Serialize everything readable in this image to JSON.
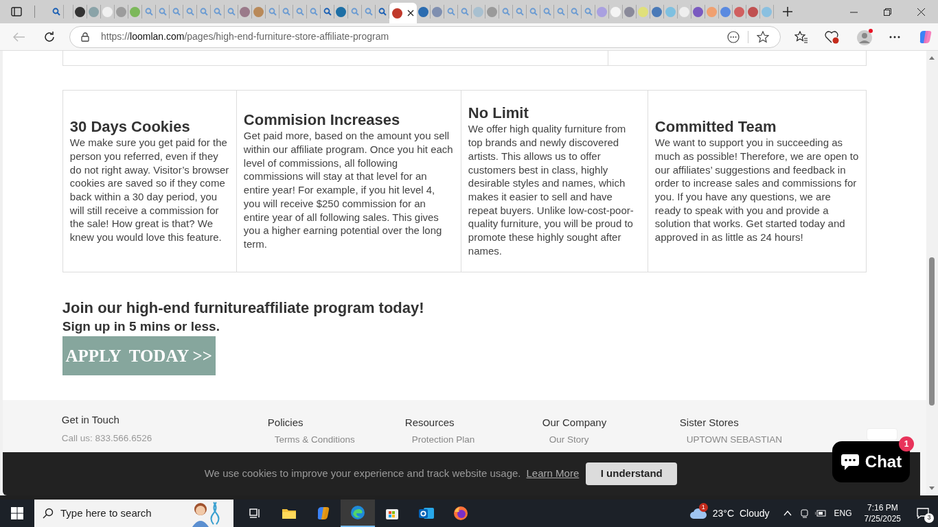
{
  "browser": {
    "tabs": [
      {
        "kind": "search",
        "selected": false,
        "color": "#1a5fb4"
      },
      {
        "kind": "site",
        "selected": false,
        "color": "#333333"
      },
      {
        "kind": "site",
        "selected": false,
        "color": "#8aa3a8"
      },
      {
        "kind": "site",
        "selected": false,
        "color": "#f0f0f0"
      },
      {
        "kind": "site",
        "selected": false,
        "color": "#9c9c9c"
      },
      {
        "kind": "site",
        "selected": false,
        "color": "#7cb85a"
      },
      {
        "kind": "search",
        "selected": false,
        "color": "#6b9bd2"
      },
      {
        "kind": "search",
        "selected": false,
        "color": "#6b9bd2"
      },
      {
        "kind": "search",
        "selected": false,
        "color": "#6b9bd2"
      },
      {
        "kind": "search",
        "selected": false,
        "color": "#6b9bd2"
      },
      {
        "kind": "search",
        "selected": false,
        "color": "#6b9bd2"
      },
      {
        "kind": "search",
        "selected": false,
        "color": "#6b9bd2"
      },
      {
        "kind": "search",
        "selected": false,
        "color": "#6b9bd2"
      },
      {
        "kind": "site",
        "selected": false,
        "color": "#9a7a8a"
      },
      {
        "kind": "site",
        "selected": false,
        "color": "#b98a5a"
      },
      {
        "kind": "search",
        "selected": false,
        "color": "#6b9bd2"
      },
      {
        "kind": "search",
        "selected": false,
        "color": "#6b9bd2"
      },
      {
        "kind": "search",
        "selected": false,
        "color": "#6b9bd2"
      },
      {
        "kind": "search",
        "selected": false,
        "color": "#6b9bd2"
      },
      {
        "kind": "search",
        "selected": false,
        "color": "#1a5fb4"
      },
      {
        "kind": "site",
        "selected": false,
        "color": "#1d6fa5"
      },
      {
        "kind": "search",
        "selected": false,
        "color": "#6b9bd2"
      },
      {
        "kind": "search",
        "selected": false,
        "color": "#6b9bd2"
      },
      {
        "kind": "search",
        "selected": false,
        "color": "#1a5fb4"
      },
      {
        "kind": "site",
        "selected": true,
        "color": "#c0392b"
      },
      {
        "kind": "site",
        "selected": false,
        "color": "#2b6cb0"
      },
      {
        "kind": "site",
        "selected": false,
        "color": "#7f8fb0"
      },
      {
        "kind": "search",
        "selected": false,
        "color": "#6b9bd2"
      },
      {
        "kind": "search",
        "selected": false,
        "color": "#6b9bd2"
      },
      {
        "kind": "site",
        "selected": false,
        "color": "#a8c0d0"
      },
      {
        "kind": "site",
        "selected": false,
        "color": "#9a9a9a"
      },
      {
        "kind": "search",
        "selected": false,
        "color": "#6b9bd2"
      },
      {
        "kind": "search",
        "selected": false,
        "color": "#6b9bd2"
      },
      {
        "kind": "search",
        "selected": false,
        "color": "#6b9bd2"
      },
      {
        "kind": "search",
        "selected": false,
        "color": "#6b9bd2"
      },
      {
        "kind": "search",
        "selected": false,
        "color": "#6b9bd2"
      },
      {
        "kind": "search",
        "selected": false,
        "color": "#6b9bd2"
      },
      {
        "kind": "search",
        "selected": false,
        "color": "#6b9bd2"
      },
      {
        "kind": "site",
        "selected": false,
        "color": "#a9a0e0"
      },
      {
        "kind": "site",
        "selected": false,
        "color": "#f4f4f4"
      },
      {
        "kind": "site",
        "selected": false,
        "color": "#8a8a9a"
      },
      {
        "kind": "site",
        "selected": false,
        "color": "#e0e07a"
      },
      {
        "kind": "site",
        "selected": false,
        "color": "#4a7ab8"
      },
      {
        "kind": "site",
        "selected": false,
        "color": "#7ec0e0"
      },
      {
        "kind": "site",
        "selected": false,
        "color": "#eeeeee"
      },
      {
        "kind": "site",
        "selected": false,
        "color": "#7a5ac0"
      },
      {
        "kind": "site",
        "selected": false,
        "color": "#f0a070"
      },
      {
        "kind": "site",
        "selected": false,
        "color": "#5a8ae0"
      },
      {
        "kind": "site",
        "selected": false,
        "color": "#d06060"
      },
      {
        "kind": "site",
        "selected": false,
        "color": "#c05050"
      },
      {
        "kind": "site",
        "selected": false,
        "color": "#8ac0e0"
      }
    ],
    "url": {
      "scheme": "https://",
      "host": "loomlan.com",
      "path": "/pages/high-end-furniture-store-affiliate-program"
    }
  },
  "features": [
    {
      "title": "30 Days Cookies",
      "text": "We make sure you get paid for the person you referred, even if they do not right away. Visitor’s browser cookies are saved so if they come back within a 30 day period, you will still receive a commission for the sale! How great is that? We knew you would love this feature."
    },
    {
      "title": "Commision Increases",
      "text": "Get paid more, based on the amount you sell within our affiliate program. Once you hit each level of commissions, all following commissions will stay at that level for an entire year! For example, if you hit level 4, you will receive $250 commission for an entire year of all following sales. This gives you a higher earning potential over the long term."
    },
    {
      "title": "No Limit",
      "text": "We offer high quality furniture from top brands and newly discovered artists. This allows us to offer customers best in class, highly desirable styles and names, which makes it easier to sell and have repeat buyers. Unlike low-cost-poor-quality furniture, you will be proud to promote these highly sought after names."
    },
    {
      "title": "Committed Team",
      "text": "We want to support you in succeeding as much as possible! Therefore, we are open to our affiliates’ suggestions and feedback in order to increase sales and commissions for you. If you have any questions, we are ready to speak with you and provide a solution that works. Get started today and approved in as little as 24 hours!"
    }
  ],
  "join": {
    "heading": "Join our high-end furnitureaffiliate program today!",
    "subheading": "Sign up in 5 mins or less.",
    "apply": "APPLY  TODAY >>"
  },
  "footer": {
    "contact": {
      "title": "Get in Touch",
      "phone": "Call us: 833.566.6526"
    },
    "columns": [
      {
        "title": "Policies",
        "link": "Terms & Conditions"
      },
      {
        "title": "Resources",
        "link": "Protection Plan"
      },
      {
        "title": "Our Company",
        "link": "Our Story"
      },
      {
        "title": "Sister Stores",
        "link": "UPTOWN SEBASTIAN"
      }
    ]
  },
  "cookie_bar": {
    "text": "We use cookies to improve your experience and track website usage.",
    "link": "Learn More",
    "button": "I understand"
  },
  "chat": {
    "label": "Chat",
    "badge": "1"
  },
  "taskbar": {
    "search_placeholder": "Type here to search",
    "apps": [
      {
        "kind": "taskview",
        "selected": false
      },
      {
        "kind": "explorer",
        "selected": false
      },
      {
        "kind": "copilot",
        "selected": false
      },
      {
        "kind": "edge",
        "selected": true
      },
      {
        "kind": "store",
        "selected": false
      },
      {
        "kind": "outlook",
        "selected": false
      },
      {
        "kind": "firefox",
        "selected": false
      }
    ],
    "weather": {
      "temp": "23°C",
      "condition": "Cloudy",
      "badge": "1"
    },
    "language": "ENG",
    "time": "7:16 PM",
    "date": "7/25/2025",
    "notifications": "3"
  }
}
